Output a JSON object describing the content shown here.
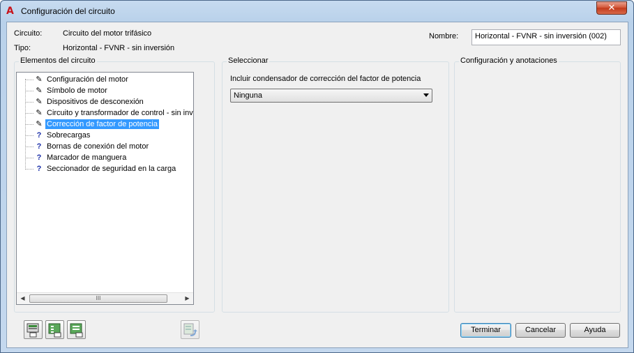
{
  "window": {
    "title": "Configuración del circuito",
    "close_label": "✕"
  },
  "header": {
    "circuit_label": "Circuito:",
    "circuit_value": "Circuito del motor trifásico",
    "type_label": "Tipo:",
    "type_value": "Horizontal - FVNR - sin inversión",
    "name_label": "Nombre:",
    "name_value": "Horizontal - FVNR - sin inversión (002)"
  },
  "elements_panel": {
    "title": "Elementos del circuito",
    "items": [
      {
        "label": "Configuración del motor",
        "icon": "pencil-icon",
        "glyph": "✎",
        "selected": false
      },
      {
        "label": "Símbolo de motor",
        "icon": "pencil-icon",
        "glyph": "✎",
        "selected": false
      },
      {
        "label": "Dispositivos de desconexión",
        "icon": "pencil-icon",
        "glyph": "✎",
        "selected": false
      },
      {
        "label": "Circuito y transformador de control - sin inver",
        "icon": "pencil-icon",
        "glyph": "✎",
        "selected": false
      },
      {
        "label": "Corrección de factor de potencia",
        "icon": "pencil-icon",
        "glyph": "✎",
        "selected": true
      },
      {
        "label": "Sobrecargas",
        "icon": "question-icon",
        "glyph": "?",
        "selected": false
      },
      {
        "label": "Bornas de conexión del motor",
        "icon": "question-icon",
        "glyph": "?",
        "selected": false
      },
      {
        "label": "Marcador de manguera",
        "icon": "question-icon",
        "glyph": "?",
        "selected": false
      },
      {
        "label": "Seccionador de seguridad en la carga",
        "icon": "question-icon",
        "glyph": "?",
        "selected": false
      }
    ],
    "scroll_left": "◀",
    "scroll_right": "▶",
    "scroll_thumb": "III"
  },
  "select_panel": {
    "title": "Seleccionar",
    "field_label": "Incluir condensador de corrección del factor de potencia",
    "field_value": "Ninguna"
  },
  "config_panel": {
    "title": "Configuración y anotaciones"
  },
  "buttons": {
    "finish": "Terminar",
    "cancel": "Cancelar",
    "help": "Ayuda"
  },
  "colors": {
    "selection": "#3399ff",
    "title_gradient": "#b9d1ea",
    "close_button": "#c23a1c",
    "default_button_border": "#3c7fb1"
  }
}
